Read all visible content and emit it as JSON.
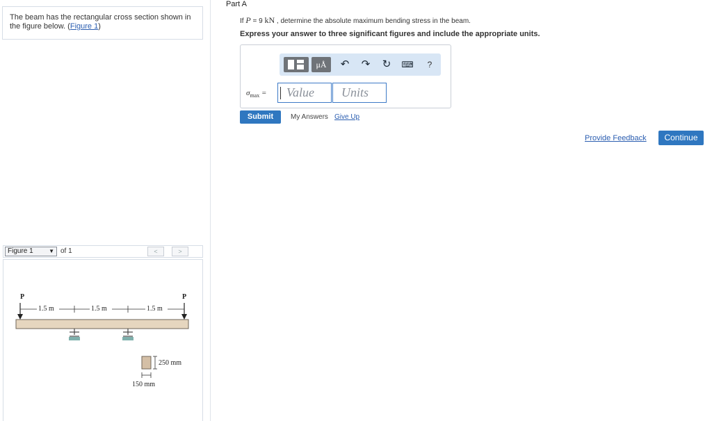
{
  "problem": {
    "text": "The beam has the rectangular cross section shown in the figure below. ",
    "link_open": "(",
    "link": "Figure 1",
    "link_close": ")"
  },
  "figure_nav": {
    "selected": "Figure 1",
    "of_label": "of 1",
    "prev": "<",
    "next": ">"
  },
  "figure": {
    "load_left": "P",
    "load_right": "P",
    "span1": "1.5 m",
    "span2": "1.5 m",
    "span3": "1.5 m",
    "height_label": "250 mm",
    "width_label": "150 mm"
  },
  "part": {
    "title": "Part A",
    "question_pre": "If ",
    "question_var": "P",
    "question_eq": " = 9 ",
    "question_unit": "kN",
    "question_post": " , determine the absolute maximum bending stress in the beam.",
    "instruction": "Express your answer to three significant figures and include the appropriate units."
  },
  "answer": {
    "sigma_symbol": "σ",
    "sigma_sub": "max",
    "equals": " =",
    "value_placeholder": "Value",
    "units_placeholder": "Units",
    "mu_label": "μÅ",
    "help_label": "?"
  },
  "actions": {
    "submit": "Submit",
    "my_answers": "My Answers",
    "give_up": "Give Up",
    "feedback": "Provide Feedback",
    "continue": "Continue"
  },
  "icons": {
    "templates": "templates-icon",
    "units": "units-icon",
    "undo": "undo-icon",
    "redo": "redo-icon",
    "reset": "reset-icon",
    "keyboard": "keyboard-icon",
    "help": "help-icon"
  },
  "colors": {
    "primary": "#2f77c0",
    "link": "#2a5db0",
    "toolbar_bg": "#d8e6f5",
    "beam": "#e6d6bf",
    "support": "#7fb0ac"
  }
}
